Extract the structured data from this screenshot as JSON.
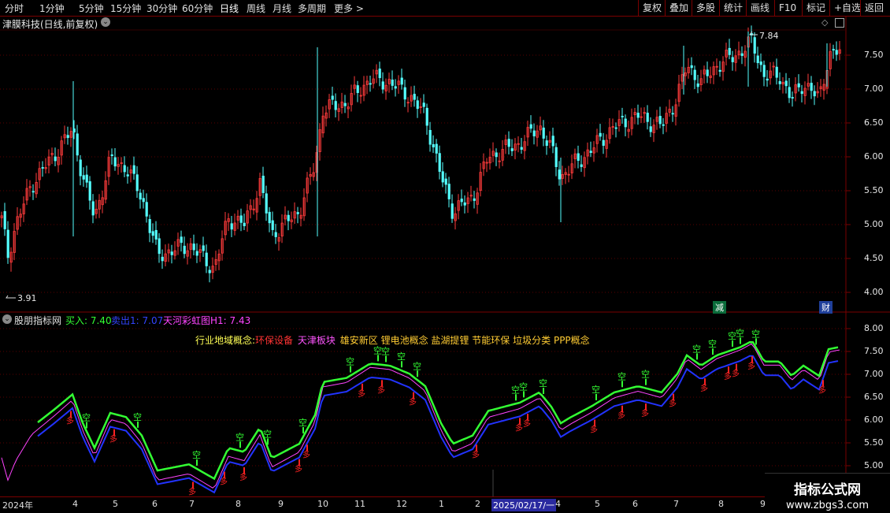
{
  "toolbar": {
    "left_items": [
      "分时",
      "1分钟",
      "5分钟",
      "15分钟",
      "30分钟",
      "60分钟",
      "日线",
      "周线",
      "月线",
      "多周期",
      "更多 >"
    ],
    "active": "日线",
    "right_items": [
      "复权",
      "叠加",
      "多股",
      "统计",
      "画线",
      "F10",
      "标记",
      "+自选",
      "返回"
    ]
  },
  "stock": {
    "title": "津膜科技(日线,前复权)",
    "high_label": "7.84",
    "low_label": "3.91",
    "price_ticks": [
      "7.50",
      "7.00",
      "6.50",
      "6.00",
      "5.50",
      "5.00",
      "4.50",
      "4.00"
    ],
    "badges": [
      "减",
      "财"
    ]
  },
  "indicator": {
    "name": "股朋指标网",
    "buy": "买入: 7.40",
    "sell": "卖出1: 7.07",
    "rainbow": "天河彩虹图H1: 7.43",
    "ticks": [
      "8.00",
      "7.50",
      "7.00",
      "6.50",
      "6.00",
      "5.50",
      "5.00"
    ],
    "concepts": [
      {
        "text": "行业地域概念:",
        "color": "#ffff55"
      },
      {
        "text": "环保设备",
        "color": "#ff3333"
      },
      {
        "text": "天津板块",
        "color": "#ff55ff"
      },
      {
        "text": "雄安新区",
        "color": "#ffcc33"
      },
      {
        "text": "锂电池概念",
        "color": "#ffcc33"
      },
      {
        "text": "盐湖提锂",
        "color": "#ffcc33"
      },
      {
        "text": "节能环保",
        "color": "#ffcc33"
      },
      {
        "text": "垃圾分类",
        "color": "#ffcc33"
      },
      {
        "text": "PPP概念",
        "color": "#ffcc33"
      }
    ],
    "kong_label": "空",
    "duo_label": "多"
  },
  "dates": {
    "months": [
      "2024年",
      "4",
      "5",
      "6",
      "7",
      "8",
      "9",
      "10",
      "11",
      "12",
      "1",
      "2",
      "2025/02/17/一",
      "4",
      "5",
      "6",
      "7",
      "8",
      "9"
    ]
  },
  "watermark": {
    "title": "指标公式网",
    "url": "www.zbgs3.com"
  },
  "colors": {
    "up": "#ff3b3b",
    "down": "#54ffff",
    "green": "#33ff33",
    "blue": "#2233ff",
    "magenta": "#ff44ff",
    "grid": "#7a0000"
  }
}
